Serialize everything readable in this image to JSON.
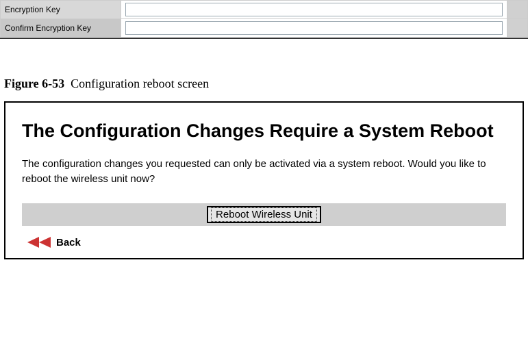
{
  "form": {
    "encryption_key": {
      "label": "Encryption Key",
      "value": ""
    },
    "confirm_encryption_key": {
      "label": "Confirm Encryption Key",
      "value": ""
    }
  },
  "figure": {
    "number": "Figure 6-53",
    "title": "Configuration reboot screen"
  },
  "screen": {
    "heading": "The Configuration Changes Require a System Reboot",
    "message": "The configuration changes you requested can only be activated via a system reboot. Would you like to reboot the wireless unit now?",
    "reboot_button": "Reboot Wireless Unit",
    "back_label": "Back"
  }
}
